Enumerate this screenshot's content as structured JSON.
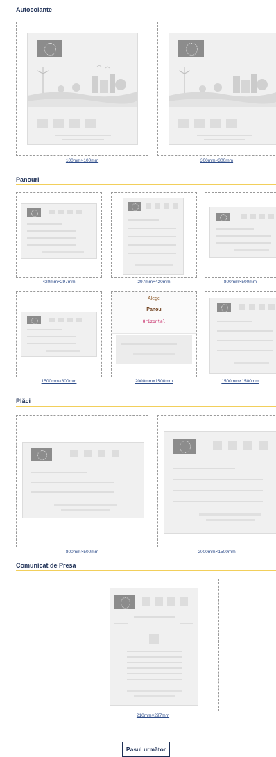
{
  "sections": {
    "autocolante": {
      "title": "Autocolante",
      "items": [
        {
          "size": "100mm×100mm"
        },
        {
          "size": "300mm×300mm"
        }
      ]
    },
    "panouri": {
      "title": "Panouri",
      "items": [
        {
          "size": "420mm×297mm"
        },
        {
          "size": "297mm×420mm"
        },
        {
          "size": "800mm×500mm"
        },
        {
          "size": "1500mm×800mm"
        },
        {
          "size": "2000mm×1500mm"
        },
        {
          "size": "1500mm×1500mm"
        }
      ],
      "overlay": {
        "choose": "Alege",
        "type": "Panou",
        "orientation": "Orizontal"
      }
    },
    "placi": {
      "title": "Plăci",
      "items": [
        {
          "size": "800mm×500mm"
        },
        {
          "size": "2000mm×1500mm"
        }
      ]
    },
    "comunicat": {
      "title": "Comunicat de Presa",
      "items": [
        {
          "size": "210mm×297mm"
        }
      ]
    }
  },
  "footer": {
    "next_label": "Pasul următor"
  },
  "colors": {
    "accent_rule": "#f2cf5b",
    "heading": "#1d2f55",
    "link": "#2e4d8a"
  }
}
